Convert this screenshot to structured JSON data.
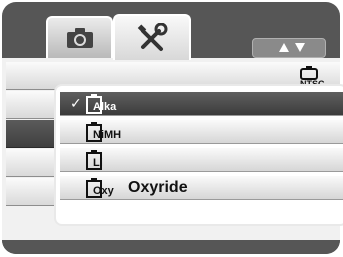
{
  "tabs": [
    {
      "name": "camera",
      "icon": "camera-icon",
      "active": false
    },
    {
      "name": "setup",
      "icon": "wrench-screwdriver-icon",
      "active": true
    }
  ],
  "scroll": {
    "up_icon": "arrow-up-icon",
    "down_icon": "arrow-down-icon"
  },
  "menu": {
    "rows": [
      {
        "icon": "tv-ntsc-icon",
        "icon_text": "NTSC"
      },
      {
        "icon": ""
      },
      {
        "icon": "",
        "highlighted": true
      },
      {
        "icon": ""
      },
      {
        "icon": ""
      }
    ]
  },
  "battery_menu": {
    "options": [
      {
        "icon": "battery-icon",
        "label": "Alka",
        "selected": true,
        "check": "✓"
      },
      {
        "icon": "battery-icon",
        "label": "NiMH"
      },
      {
        "icon": "battery-icon",
        "label": "Li"
      },
      {
        "icon": "battery-icon",
        "label": "Oxy",
        "text": "Oxyride"
      }
    ]
  },
  "colors": {
    "frame": "#565656",
    "highlight": "#454545",
    "row_light": "#e8e8e8",
    "accent_white": "#ffffff"
  }
}
